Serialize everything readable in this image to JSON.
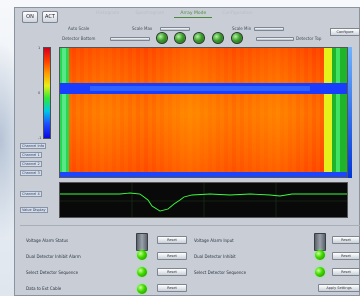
{
  "toolbar": {
    "buttons": [
      "ON",
      "ACT"
    ]
  },
  "tabs": [
    {
      "label": "Histogram",
      "active": false
    },
    {
      "label": "Spectrogram",
      "active": false
    },
    {
      "label": "Array Mode",
      "active": true
    },
    {
      "label": "Configuration",
      "active": false
    }
  ],
  "controls": {
    "labels": [
      "Auto Scale",
      "Scale Max",
      "Scale Min",
      "Detector Bottom",
      "Detector Top"
    ],
    "config_button": "Configure"
  },
  "colorbar": {
    "ticks": [
      "1",
      "0",
      "-1"
    ]
  },
  "side_labels": [
    "Channel Info",
    "Channel 1",
    "Channel 2",
    "Channel 3",
    "Channel 4",
    "Value Display"
  ],
  "bottom": {
    "left_rows": [
      "Voltage Alarm Status",
      "Dual Detector Inhibit Alarm",
      "Select Detector Sequence",
      "Data to Ext Cable"
    ],
    "right_rows": [
      "Voltage Alarm Input",
      "Dual Detector Inhibit",
      "Select Detector Sequence"
    ],
    "left_buttons": [
      "Reset",
      "Reset",
      "Reset",
      "Reset"
    ],
    "right_buttons": [
      "Reset",
      "Reset",
      "Reset"
    ],
    "apply_button": "Apply Settings"
  },
  "colors": {
    "accent": "#2aa12a",
    "active_tab": "#4c8a3a"
  }
}
